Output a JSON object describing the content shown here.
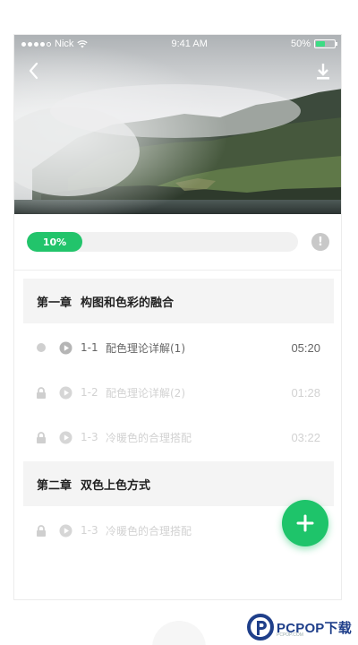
{
  "status_bar": {
    "carrier": "Nick",
    "time": "9:41 AM",
    "battery_text": "50%",
    "battery_level": 0.5
  },
  "header": {
    "back_icon": "chevron-left-icon",
    "download_icon": "download-icon"
  },
  "progress": {
    "value": 0.1,
    "label": "10%",
    "info_icon": "exclamation-icon"
  },
  "chapters": [
    {
      "number": "第一章",
      "title": "构图和色彩的融合",
      "lessons": [
        {
          "state": "current",
          "number": "1-1",
          "title": "配色理论详解(1)",
          "duration": "05:20"
        },
        {
          "state": "locked",
          "number": "1-2",
          "title": "配色理论详解(2)",
          "duration": "01:28"
        },
        {
          "state": "locked",
          "number": "1-3",
          "title": "冷暖色的合理搭配",
          "duration": "03:22"
        }
      ]
    },
    {
      "number": "第二章",
      "title": "双色上色方式",
      "lessons": [
        {
          "state": "locked",
          "number": "1-3",
          "title": "冷暖色的合理搭配",
          "duration": ""
        }
      ]
    }
  ],
  "fab": {
    "icon": "plus-icon"
  },
  "colors": {
    "accent": "#1ec46a",
    "progress_track": "#f1f1f1",
    "chapter_bg": "#f4f4f4",
    "locked_text": "#d2d2d2"
  },
  "watermark": {
    "brand": "PCPOP下载",
    "sub": "PCPOP.COM"
  }
}
